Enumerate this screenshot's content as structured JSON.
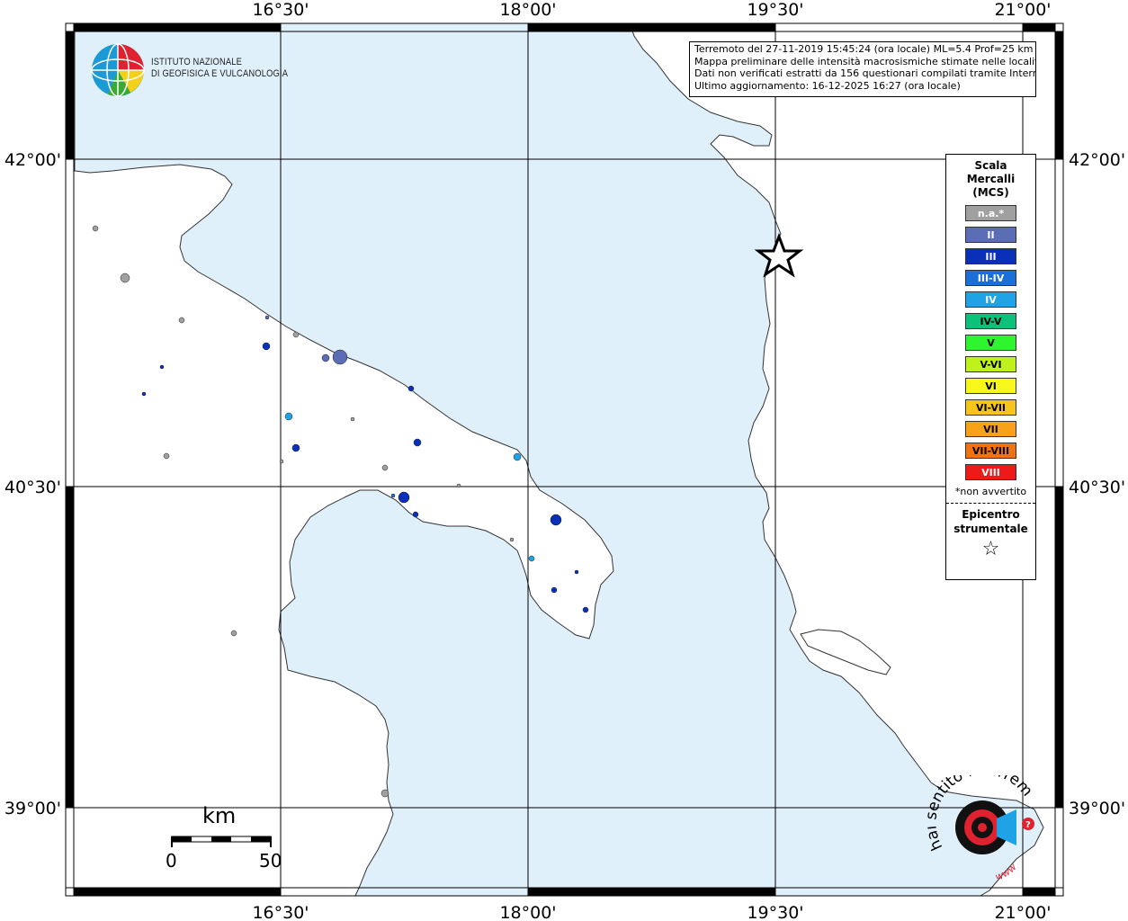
{
  "map": {
    "lon_labels": [
      "16°30'",
      "18°00'",
      "19°30'",
      "21°00'"
    ],
    "lat_labels": [
      "42°00'",
      "40°30'",
      "39°00'"
    ],
    "colors": {
      "sea": "#dff0fb",
      "land": "#ffffff",
      "grid": "#000000"
    }
  },
  "info": {
    "line1": "Terremoto del 27-11-2019 15:45:24 (ora locale) ML=5.4 Prof=25 km",
    "line2": "Mappa preliminare delle intensità macrosismiche stimate nelle località",
    "line3": "Dati non verificati estratti da 156 questionari compilati tramite Internet.",
    "line4": "Ultimo aggiornamento: 16-12-2025 16:27 (ora locale)"
  },
  "logo": {
    "line1": "ISTITUTO NAZIONALE",
    "line2": "DI GEOFISICA E VULCANOLOGIA"
  },
  "legend": {
    "title_line1": "Scala",
    "title_line2": "Mercalli",
    "title_line3": "(MCS)",
    "items": [
      {
        "label": "n.a.*",
        "color": "#a0a0a0",
        "text": "#ffffff"
      },
      {
        "label": "II",
        "color": "#5b6db5",
        "text": "#ffffff"
      },
      {
        "label": "III",
        "color": "#0a2fb8",
        "text": "#ffffff"
      },
      {
        "label": "III-IV",
        "color": "#1a6fd8",
        "text": "#ffffff"
      },
      {
        "label": "IV",
        "color": "#1fa3e6",
        "text": "#ffffff"
      },
      {
        "label": "IV-V",
        "color": "#0cc27a",
        "text": "#000000"
      },
      {
        "label": "V",
        "color": "#2ef52e",
        "text": "#000000"
      },
      {
        "label": "V-VI",
        "color": "#bff21b",
        "text": "#000000"
      },
      {
        "label": "VI",
        "color": "#f7f71a",
        "text": "#000000"
      },
      {
        "label": "VI-VII",
        "color": "#f7c41a",
        "text": "#000000"
      },
      {
        "label": "VII",
        "color": "#f8a21a",
        "text": "#000000"
      },
      {
        "label": "VII-VIII",
        "color": "#f2720e",
        "text": "#000000"
      },
      {
        "label": "VIII",
        "color": "#ee1a1a",
        "text": "#ffffff"
      }
    ],
    "note": "*non avvertito",
    "epicenter_line1": "Epicentro",
    "epicenter_line2": "strumentale"
  },
  "scale": {
    "unit": "km",
    "min": "0",
    "max": "50"
  },
  "watermark": {
    "text": "hai sentito il terremoto.it",
    "sub": "www"
  }
}
